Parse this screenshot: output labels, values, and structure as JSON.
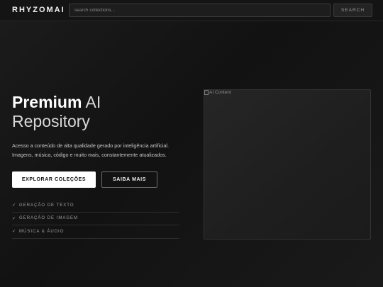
{
  "header": {
    "logo": "RHYZOMAI",
    "search_placeholder": "search collections...",
    "search_button": "SEARCH"
  },
  "hero": {
    "title_strong": "Premium",
    "title_rest": " AI Repository",
    "description_line1": "Acesso a conteúdo de alta qualidade gerado por inteligência artificial.",
    "description_line2": "Imagens, música, código e muito mais, constantemente atualizados.",
    "primary_button": "EXPLORAR COLEÇÕES",
    "secondary_button": "SAIBA MAIS"
  },
  "features": [
    {
      "check": "✓",
      "label": "GERAÇÃO DE TEXTO"
    },
    {
      "check": "✓",
      "label": "GERAÇÃO DE IMAGEM"
    },
    {
      "check": "✓",
      "label": "MÚSICA & ÁUDIO"
    }
  ],
  "image_card": {
    "alt_text": "AI Content",
    "icon": "broken-image-icon"
  }
}
